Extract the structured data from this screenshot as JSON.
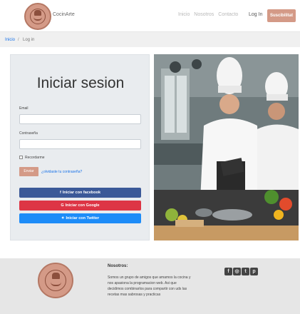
{
  "brand": {
    "name": "CocinArte"
  },
  "nav": {
    "links": [
      "Inicio",
      "Nosotros",
      "Contacto"
    ],
    "login": "Log In",
    "subscribe": "Suscibilitat"
  },
  "breadcrumb": {
    "home": "Inicio",
    "separator": "/",
    "current": "Log in"
  },
  "login": {
    "title": "Iniciar sesion",
    "email_label": "Email",
    "email_value": "",
    "password_label": "Contraseña",
    "password_value": "",
    "remember_label": "Recordarme",
    "send_button": "Enviar",
    "forgot_link": "¿olvidaste tu contraseña?",
    "social": {
      "facebook": "Iniciar con facebook",
      "google": "Iniciar con Google",
      "twitter": "Iniciar con Twitter"
    }
  },
  "photo": {
    "subject": "chefs-cooking-photo"
  },
  "footer": {
    "title": "Nosotros:",
    "text": "Somos un grupo de amigos que amamos la cocina y nos apasiona la programacion web. Asi que decidimos combinarlos para compartir con uds las recetas mas sabrosas y practicas",
    "social_icons": [
      "facebook-icon",
      "instagram-icon",
      "twitter-icon",
      "pinterest-icon"
    ]
  },
  "colors": {
    "accent": "#d49a87",
    "facebook": "#3b5998",
    "google": "#dd3545",
    "twitter": "#1d8cf8",
    "link": "#1a73e8"
  }
}
